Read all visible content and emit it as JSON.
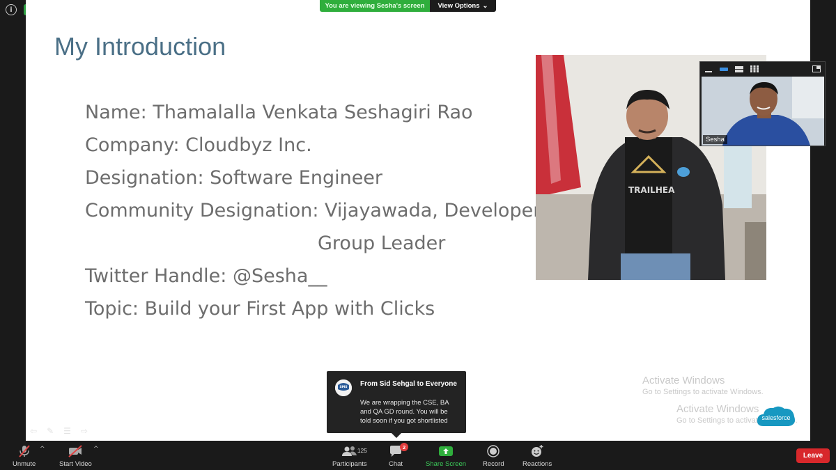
{
  "banner": {
    "viewing": "You are viewing Sesha's screen",
    "view_options": "View Options"
  },
  "slide": {
    "title": "My Introduction",
    "lines": [
      "Name: Thamalalla Venkata Seshagiri Rao",
      "Company: Cloudbyz Inc.",
      "Designation: Software Engineer",
      "Community Designation: Vijayawada, Developer",
      "Group Leader",
      "Twitter Handle: @Sesha__",
      "Topic: Build your First App with Clicks"
    ],
    "shirt_text": "TRAILHEA",
    "watermarks": [
      {
        "title": "Activate Windows",
        "sub": "Go to Settings to activate Windows."
      },
      {
        "title": "Activate Windows",
        "sub": "Go to Settings to activate Windows."
      }
    ],
    "logo": "salesforce"
  },
  "video": {
    "name": "Sesha"
  },
  "chat_toast": {
    "avatar_text": "SMS",
    "from": "From Sid Sehgal to Everyone",
    "message": "We are wrapping the CSE, BA and QA GD round. You will be told soon if you got shortlisted"
  },
  "toolbar": {
    "unmute": "Unmute",
    "start_video": "Start Video",
    "participants": "Participants",
    "participants_count": "125",
    "chat": "Chat",
    "chat_badge": "2",
    "share_screen": "Share Screen",
    "record": "Record",
    "reactions": "Reactions",
    "leave": "Leave"
  },
  "colors": {
    "share_green": "#2fae3c",
    "leave_red": "#d8282b",
    "title_blue": "#4a6f86"
  }
}
